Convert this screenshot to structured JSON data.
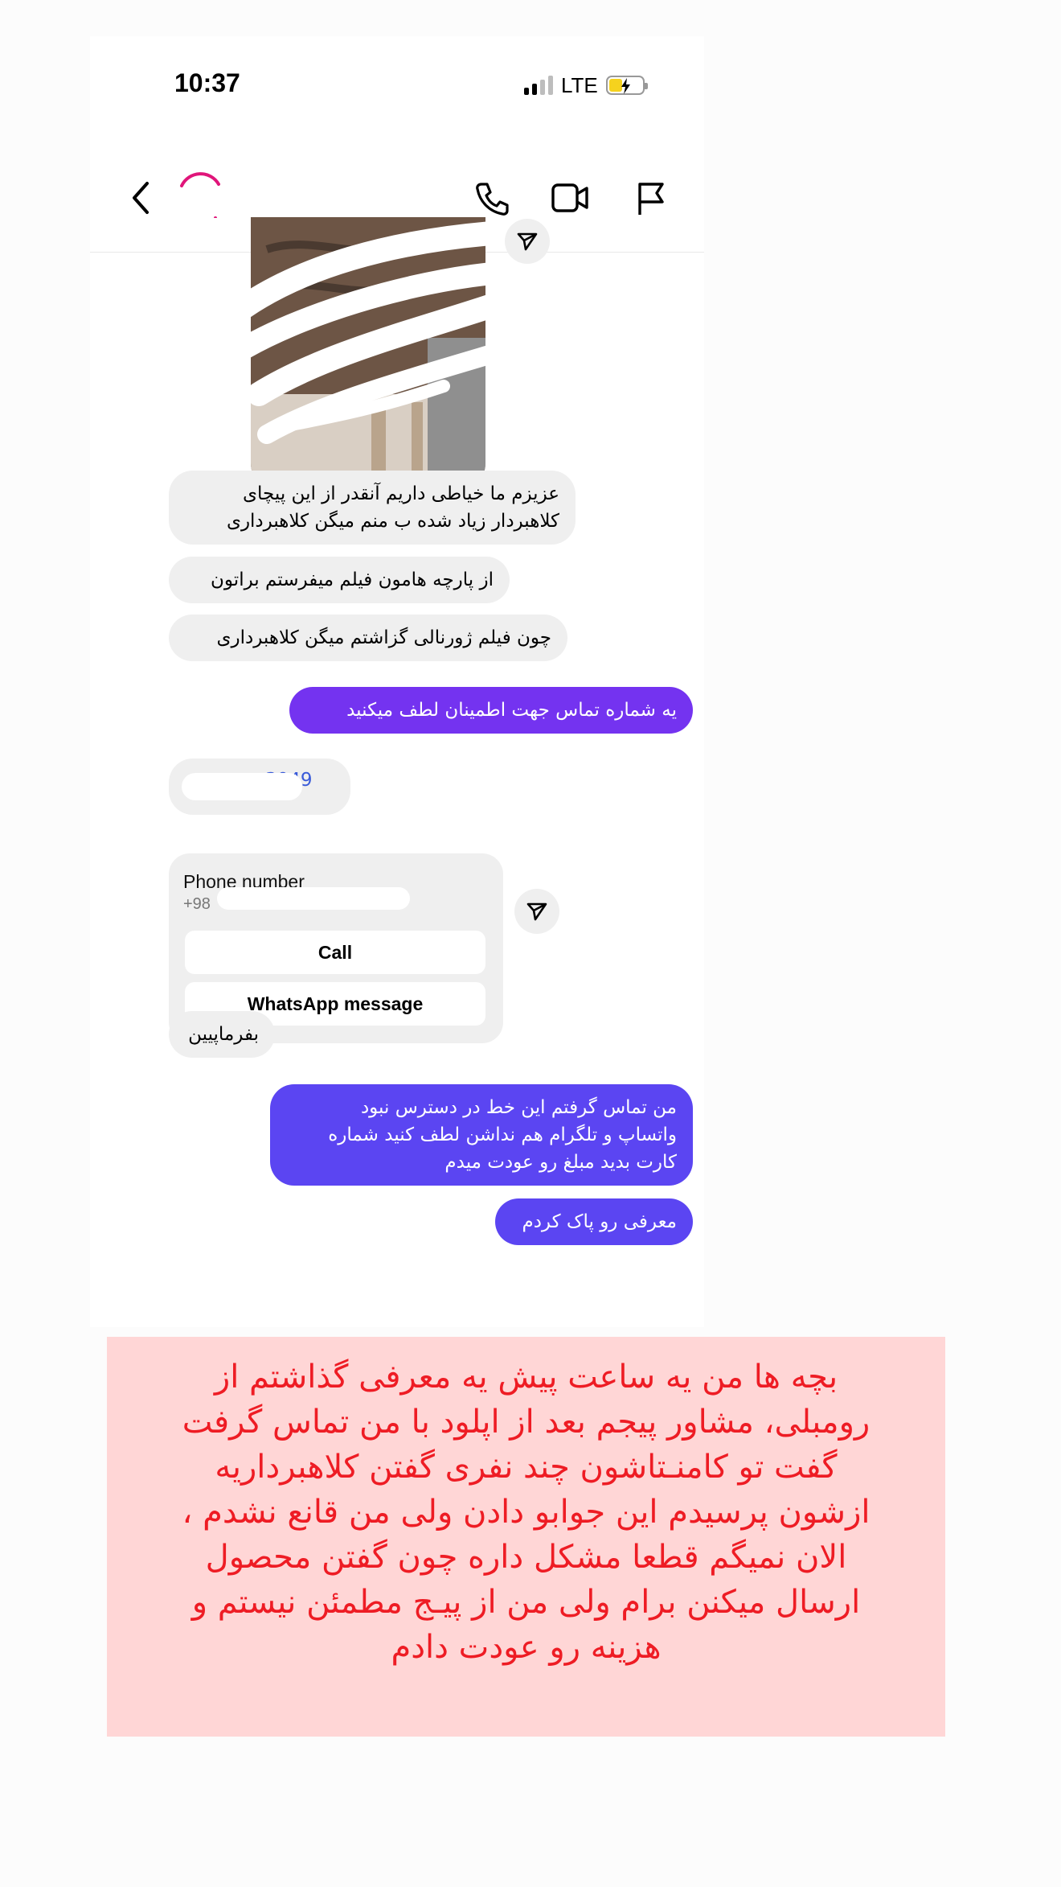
{
  "status_bar": {
    "time": "10:37",
    "network": "LTE"
  },
  "header": {
    "back_icon": "chevron-left-icon",
    "call_icon": "phone-icon",
    "video_icon": "video-camera-icon",
    "report_icon": "flag-icon"
  },
  "messages": [
    {
      "side": "in",
      "text": "عزیزم ما خیاطی داریم آنقدر از این پیچای\nکلاهبردار زیاد شده ب منم میگن کلاهبرداری"
    },
    {
      "side": "in",
      "text": "از پارچه هامون فیلم میفرستم براتون"
    },
    {
      "side": "in",
      "text": "چون فیلم ژورنالی گزاشتم میگن کلاهبرداری"
    },
    {
      "side": "out",
      "text": "یه شماره تماس جهت اطمینان لطف میکنید"
    },
    {
      "side": "in",
      "text": "3049"
    },
    {
      "side": "in",
      "text": "بفرماپیین"
    },
    {
      "side": "out",
      "text": "من تماس گرفتم این خط در دسترس نبود\nواتساپ و تلگرام هم نداشن لطف کنید شماره\nکارت بدید مبلغ رو عودت میدم"
    },
    {
      "side": "out",
      "text": "معرفی رو پاک کردم"
    }
  ],
  "phone_card": {
    "title": "Phone number",
    "number_prefix": "+98",
    "call_label": "Call",
    "whatsapp_label": "WhatsApp message"
  },
  "colors": {
    "out_purple": "#7433f0",
    "out_indigo": "#5b45f2",
    "in_gray": "#efefef",
    "caption_red": "#ee1c24",
    "caption_bg": "#ffd6d6"
  },
  "caption": "بچه ها من یه ساعت پیش یه معرفی گذاشتم از\nرومبلی، مشاور پیجم بعد از اپلود با من تماس گرفت\nگفت  تو کامنـتاشون چند نفری گفتن کلاهبرداریه\nازشون پرسیدم این جوابو دادن ولی من قانع نشدم ،\nالان نمیگم قطعا مشکل داره چون گفتن محصول\nارسال میکنن برام ولی من از پیـج مطمئن نیستم و\nهزینه رو عودت دادم"
}
